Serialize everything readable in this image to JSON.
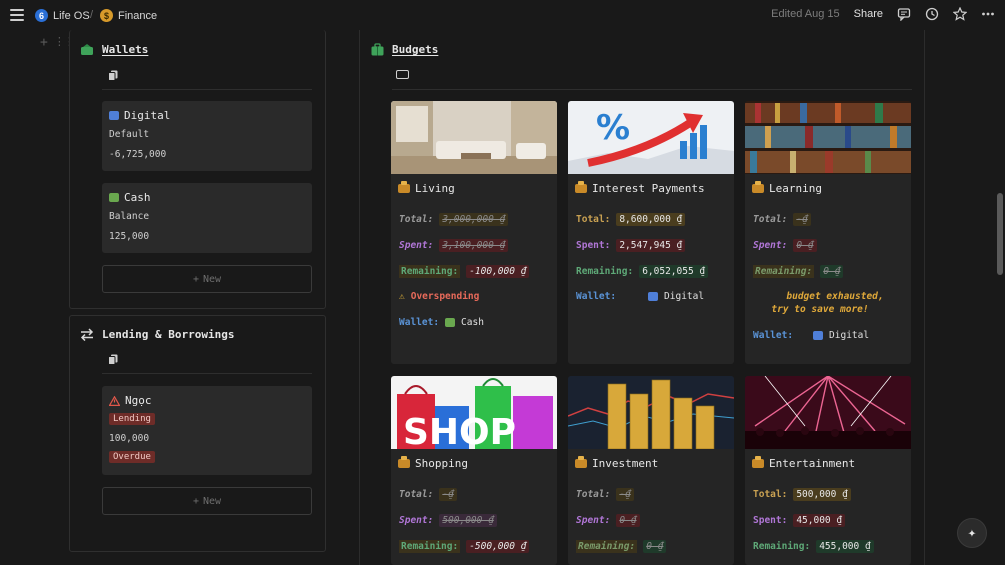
{
  "topbar": {
    "workspace": "Life OS",
    "separator": "/",
    "page": "Finance",
    "edited": "Edited Aug 15",
    "share": "Share",
    "icons": [
      "menu-icon",
      "comment-icon",
      "history-icon",
      "star-icon",
      "more-icon"
    ]
  },
  "wallets": {
    "title": "Wallets",
    "items": [
      {
        "name": "Digital",
        "line1": "Default",
        "line2": "-6,725,000",
        "icon": "credit-card-icon"
      },
      {
        "name": "Cash",
        "line1": "Balance",
        "line2": "125,000",
        "icon": "cash-icon"
      }
    ],
    "new_label": "New"
  },
  "lending": {
    "title": "Lending & Borrowings",
    "items": [
      {
        "name": "Ngọc",
        "tag1": "Lending",
        "amount": "100,000",
        "tag2": "Overdue",
        "icon": "warning-icon"
      }
    ],
    "new_label": "New"
  },
  "budgets": {
    "title": "Budgets",
    "labels": {
      "total": "Total:",
      "spent": "Spent:",
      "remaining": "Remaining:",
      "wallet": "Wallet:"
    },
    "cards": [
      {
        "name": "Living",
        "total": "3,000,000 ₫",
        "spent": "3,100,000 ₫",
        "remaining": "-100,000 ₫",
        "status": "Overspending",
        "wallet": "Cash",
        "cover": "living-room"
      },
      {
        "name": "Interest Payments",
        "total": "8,600,000 ₫",
        "spent": "2,547,945 ₫",
        "remaining": "6,052,055 ₫",
        "wallet": "Digital",
        "cover": "percent-chart"
      },
      {
        "name": "Learning",
        "total": "-₫",
        "spent": "0 ₫",
        "remaining": "0 ₫",
        "note1": "budget exhausted,",
        "note2": "try to save more!",
        "wallet": "Digital",
        "cover": "bookshelf"
      },
      {
        "name": "Shopping",
        "total": "-₫",
        "spent": "500,000 ₫",
        "remaining": "-500,000 ₫",
        "cover": "shopping-bags",
        "cover_text": "SHOP"
      },
      {
        "name": "Investment",
        "total": "-₫",
        "spent": "0 ₫",
        "remaining": "0 ₫",
        "cover": "coins"
      },
      {
        "name": "Entertainment",
        "total": "500,000 ₫",
        "spent": "45,000 ₫",
        "remaining": "455,000 ₫",
        "cover": "concert"
      }
    ]
  },
  "colors": {
    "background": "#191919",
    "card": "#252525",
    "total": "#c9a152",
    "spent": "#b076d6",
    "remaining": "#5ea877",
    "wallet": "#5a93d6",
    "danger": "#e86a5a"
  }
}
